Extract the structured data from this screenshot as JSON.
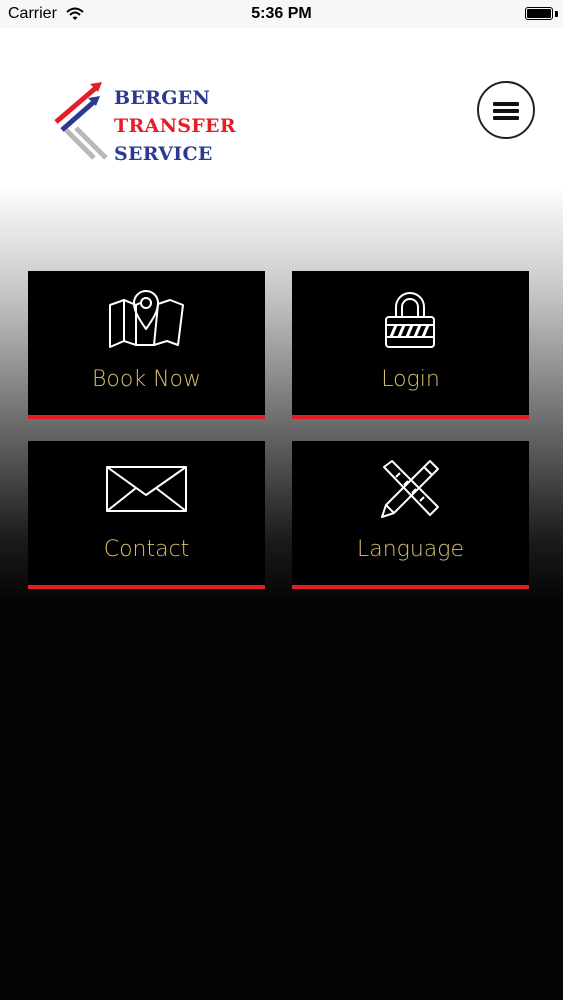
{
  "status_bar": {
    "carrier": "Carrier",
    "time": "5:36 PM"
  },
  "logo": {
    "line1": "BERGEN",
    "line2": "TRANSFER",
    "line3": "SERVICE"
  },
  "colors": {
    "accent_red": "#e41e26",
    "label_gold": "#d8c06a",
    "logo_blue": "#2b3a8f"
  },
  "tiles": [
    {
      "label": "Book Now",
      "icon": "map-pin-icon"
    },
    {
      "label": "Login",
      "icon": "lock-icon"
    },
    {
      "label": "Contact",
      "icon": "envelope-icon"
    },
    {
      "label": "Language",
      "icon": "pencil-ruler-icon"
    }
  ]
}
